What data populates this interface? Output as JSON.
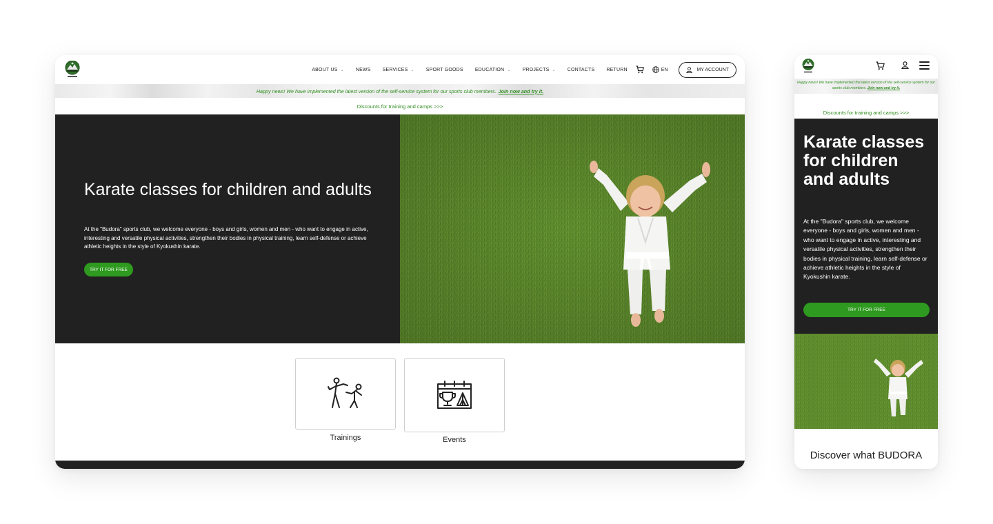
{
  "desktop": {
    "nav": {
      "items": [
        {
          "label": "ABOUT US",
          "dropdown": true
        },
        {
          "label": "NEWS",
          "dropdown": false
        },
        {
          "label": "SERVICES",
          "dropdown": true
        },
        {
          "label": "SPORT GOODS",
          "dropdown": false
        },
        {
          "label": "EDUCATION",
          "dropdown": true
        },
        {
          "label": "PROJECTS",
          "dropdown": true
        },
        {
          "label": "CONTACTS",
          "dropdown": false
        },
        {
          "label": "RETURN",
          "dropdown": false
        }
      ],
      "language": "EN",
      "account_label": "MY ACCOUNT",
      "icons": {
        "cart": "cart-icon",
        "globe": "globe-icon",
        "user": "user-icon",
        "logo": "budora-logo"
      }
    },
    "banner": {
      "text": "Happy news! We have implemented the latest version of the self-service system for our sports club members.",
      "link": "Join now and try it."
    },
    "discounts": "Discounts for training and camps >>>",
    "hero": {
      "title": "Karate classes for children and adults",
      "text": "At the \"Budora\" sports club, we welcome everyone - boys and girls, women and men - who want to engage in active, interesting and versatile physical activities, strengthen their bodies in physical training, learn self-defense or achieve athletic heights in the style of Kyokushin karate.",
      "cta": "TRY IT FOR FREE"
    },
    "cards": [
      {
        "label": "Trainings",
        "icon": "karate-fighters-icon"
      },
      {
        "label": "Events",
        "icon": "calendar-trophy-tent-icon"
      }
    ]
  },
  "mobile": {
    "banner": {
      "text": "Happy news! We have implemented the latest version of the self-service system for our sports club members.",
      "link": "Join now and try it."
    },
    "discounts": "Discounts for training and camps >>>",
    "hero": {
      "title": "Karate classes for children and adults",
      "text": "At the \"Budora\" sports club, we welcome everyone - boys and girls, women and men - who want to engage in active, interesting and versatile physical activities, strengthen their bodies in physical training, learn self-defense or achieve athletic heights in the style of Kyokushin karate.",
      "cta": "TRY IT FOR FREE"
    },
    "section_title": "Discover what BUDORA",
    "icons": {
      "cart": "cart-icon",
      "user": "user-icon",
      "menu": "hamburger-menu-icon"
    }
  },
  "colors": {
    "accent": "#2e9a1f",
    "accent_text": "#2f8d1f",
    "dark": "#212121"
  }
}
